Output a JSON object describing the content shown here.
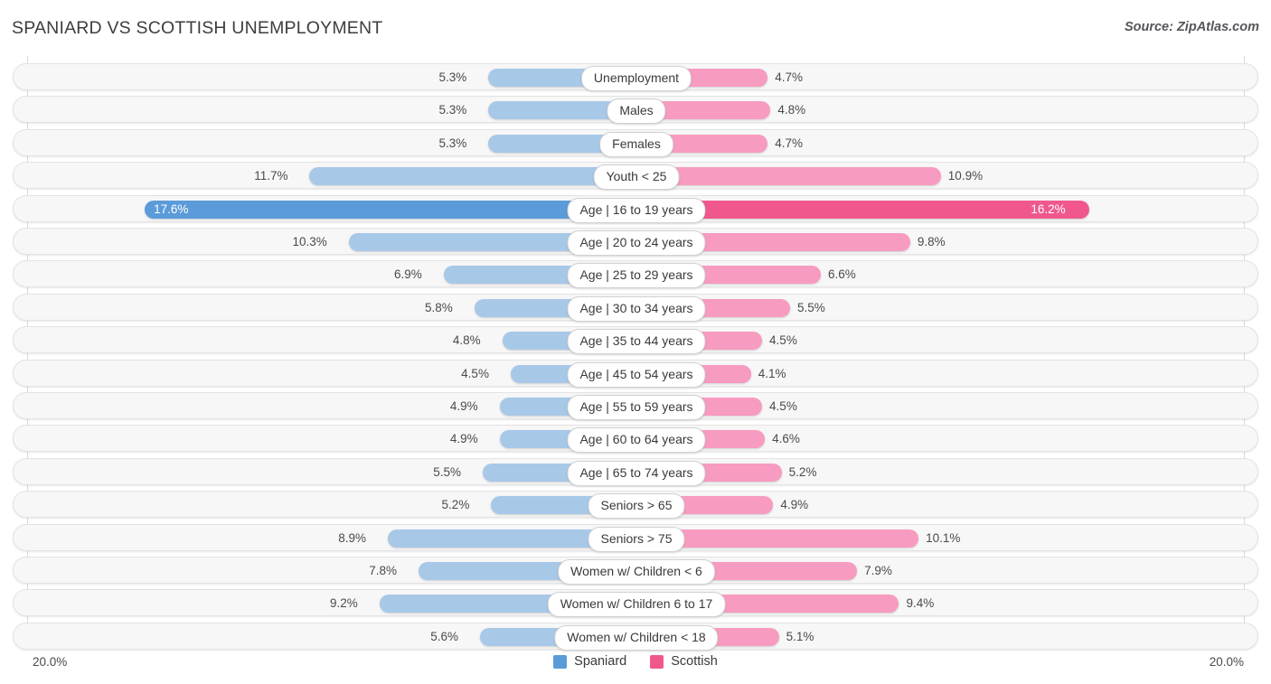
{
  "header": {
    "title": "SPANIARD VS SCOTTISH UNEMPLOYMENT",
    "source": "Source: ZipAtlas.com"
  },
  "legend": {
    "items": [
      {
        "label": "Spaniard",
        "color": "#5b9bd9"
      },
      {
        "label": "Scottish",
        "color": "#f0588d"
      }
    ]
  },
  "axis": {
    "left_label": "20.0%",
    "right_label": "20.0%",
    "max": 20.0
  },
  "colors": {
    "left_normal": "#a8c8e8",
    "left_highlight": "#5b9bd9",
    "right_normal": "#f89bc0",
    "right_highlight": "#f0588d",
    "row_track": "#f7f7f7",
    "row_border": "#e3e3e3",
    "gridline": "#d9d9d9"
  },
  "chart_data": {
    "type": "bar",
    "orientation": "horizontal-diverging",
    "title": "SPANIARD VS SCOTTISH UNEMPLOYMENT",
    "xlabel": "",
    "ylabel": "",
    "xlim": [
      20.0,
      20.0
    ],
    "grid": true,
    "legend_position": "bottom-center",
    "categories": [
      "Unemployment",
      "Males",
      "Females",
      "Youth < 25",
      "Age | 16 to 19 years",
      "Age | 20 to 24 years",
      "Age | 25 to 29 years",
      "Age | 30 to 34 years",
      "Age | 35 to 44 years",
      "Age | 45 to 54 years",
      "Age | 55 to 59 years",
      "Age | 60 to 64 years",
      "Age | 65 to 74 years",
      "Seniors > 65",
      "Seniors > 75",
      "Women w/ Children < 6",
      "Women w/ Children 6 to 17",
      "Women w/ Children < 18"
    ],
    "series": [
      {
        "name": "Spaniard",
        "color": "#5b9bd9",
        "values": [
          5.3,
          5.3,
          5.3,
          11.7,
          17.6,
          10.3,
          6.9,
          5.8,
          4.8,
          4.5,
          4.9,
          4.9,
          5.5,
          5.2,
          8.9,
          7.8,
          9.2,
          5.6
        ],
        "labels": [
          "5.3%",
          "5.3%",
          "5.3%",
          "11.7%",
          "17.6%",
          "10.3%",
          "6.9%",
          "5.8%",
          "4.8%",
          "4.5%",
          "4.9%",
          "4.9%",
          "5.5%",
          "5.2%",
          "8.9%",
          "7.8%",
          "9.2%",
          "5.6%"
        ]
      },
      {
        "name": "Scottish",
        "color": "#f0588d",
        "values": [
          4.7,
          4.8,
          4.7,
          10.9,
          16.2,
          9.8,
          6.6,
          5.5,
          4.5,
          4.1,
          4.5,
          4.6,
          5.2,
          4.9,
          10.1,
          7.9,
          9.4,
          5.1
        ],
        "labels": [
          "4.7%",
          "4.8%",
          "4.7%",
          "10.9%",
          "16.2%",
          "9.8%",
          "6.6%",
          "5.5%",
          "4.5%",
          "4.1%",
          "4.5%",
          "4.6%",
          "5.2%",
          "4.9%",
          "10.1%",
          "7.9%",
          "9.4%",
          "5.1%"
        ]
      }
    ],
    "highlighted_row_index": 4
  }
}
